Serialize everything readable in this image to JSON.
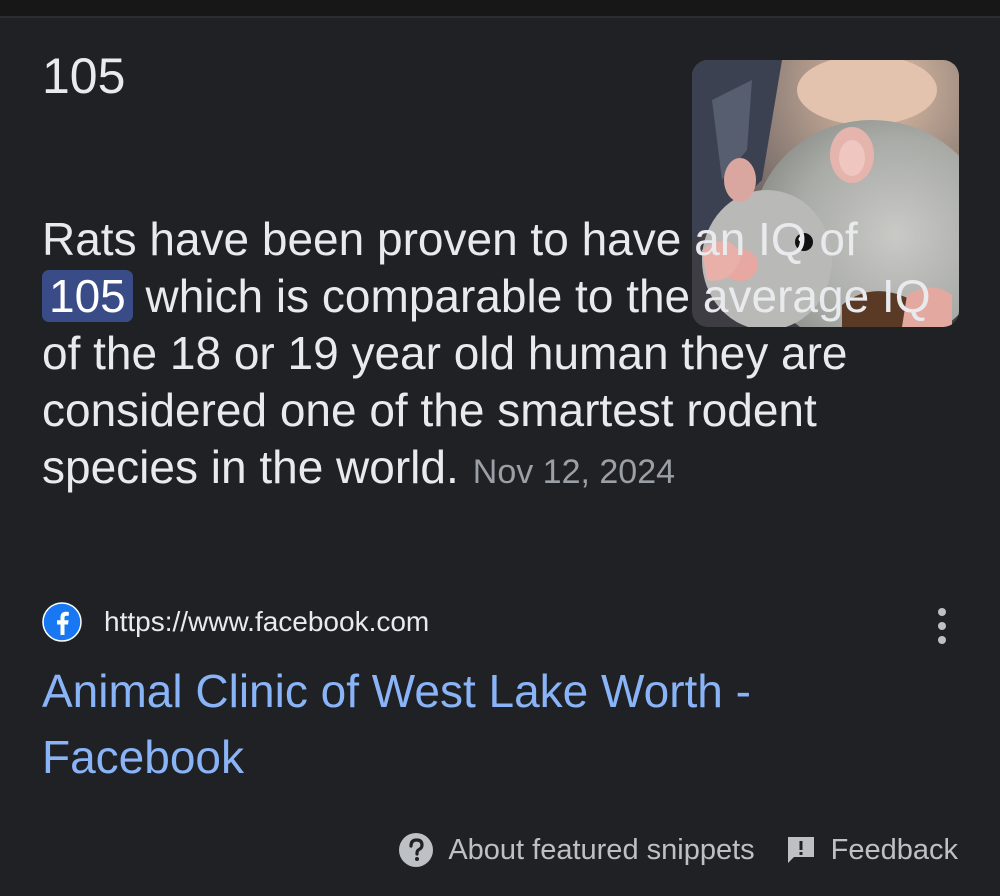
{
  "answer": {
    "title": "105"
  },
  "snippet": {
    "text_before": "Rats have been proven to have an IQ of ",
    "highlight": "105",
    "text_after": " which is comparable to the average IQ of the 18 or 19 year old human they are considered one of the smartest rodent species in the world.",
    "date": "Nov 12, 2024"
  },
  "thumbnail": {
    "subject": "rat-photo"
  },
  "source": {
    "icon": "facebook-icon",
    "url": "https://www.facebook.com",
    "more_icon": "more-vertical-icon"
  },
  "result": {
    "title": "Animal Clinic of West Lake Worth - Facebook"
  },
  "footer": {
    "about_label": "About featured snippets",
    "about_icon": "help-circle-icon",
    "feedback_label": "Feedback",
    "feedback_icon": "feedback-icon"
  },
  "colors": {
    "background": "#202124",
    "text": "#e8eaed",
    "link": "#8ab4f8",
    "highlight": "#394c87",
    "muted": "#9aa0a6",
    "facebook_blue": "#1877f2"
  }
}
